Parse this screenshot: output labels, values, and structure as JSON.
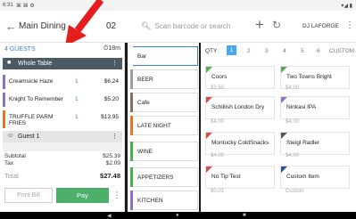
{
  "status": {
    "time": "6:31",
    "left_icons": "⌘ ⌘ ⚙",
    "right_icons": "▾◢ ▮"
  },
  "header": {
    "back_icon": "←",
    "title": "Main Dining",
    "title_num": "02",
    "search_placeholder": "Scan barcode or search",
    "user": "DJ LAFORGE"
  },
  "order": {
    "guests_label": "4 GUESTS",
    "timer": "18m",
    "whole_table_label": "Whole Table",
    "items": [
      {
        "name": "Creamsicle Haze",
        "qty": "1",
        "price": "$6.24"
      },
      {
        "name": "Knight To Remember",
        "qty": "1",
        "price": "$5.20"
      },
      {
        "name": "TRUFFLE PARM FRIES",
        "qty": "1",
        "price": "$13.95"
      }
    ],
    "guest_label": "Guest 1",
    "subtotal_label": "Subtotal",
    "subtotal": "$25.39",
    "tax_label": "Tax",
    "tax": "$2.09",
    "total_label": "Total",
    "total": "$27.48",
    "print_label": "Print Bill",
    "pay_label": "Pay"
  },
  "categories": [
    {
      "label": "Bar",
      "color": "#ffffff",
      "selected": true
    },
    {
      "label": "BEER",
      "color": "#9e9e9e"
    },
    {
      "label": "Cafe",
      "color": "#8d6e5a"
    },
    {
      "label": "LATE NIGHT",
      "color": "#e8742a"
    },
    {
      "label": "WINE",
      "color": "#4caf50"
    },
    {
      "label": "APPETIZERS",
      "color": "#4caf50"
    },
    {
      "label": "KITCHEN",
      "color": "#8d6fc4"
    }
  ],
  "qty": {
    "label": "QTY",
    "numbers": [
      "1",
      "2",
      "3",
      "4",
      "5",
      "6"
    ],
    "active": "1",
    "custom": "CUSTOM"
  },
  "tiles": [
    {
      "name": "Coors",
      "price": "$3.50",
      "color": "#4caf50"
    },
    {
      "name": "Two Towns Bright",
      "price": "$4.00",
      "color": "#4caf50"
    },
    {
      "name": "Schillish London Dry",
      "price": "$4.00",
      "color": "#d84a4a"
    },
    {
      "name": "Ninkasi IPA",
      "price": "$4.00",
      "color": "#8d6fc4"
    },
    {
      "name": "Montucky ColdSnacks",
      "price": "$4.00",
      "color": "#d84a4a"
    },
    {
      "name": "Steigl Radler",
      "price": "$4.00",
      "color": "#555555"
    },
    {
      "name": "No Tip Test",
      "price": "$0.01",
      "color": "#d84a4a"
    },
    {
      "name": "Custom Item",
      "price": "Custom",
      "color": "#2a4ea8"
    }
  ],
  "colors": {
    "accent": "#3a7fd9",
    "pay": "#4caf6a",
    "whole_table": "#4d5a63",
    "arrow": "#e41e1e"
  }
}
